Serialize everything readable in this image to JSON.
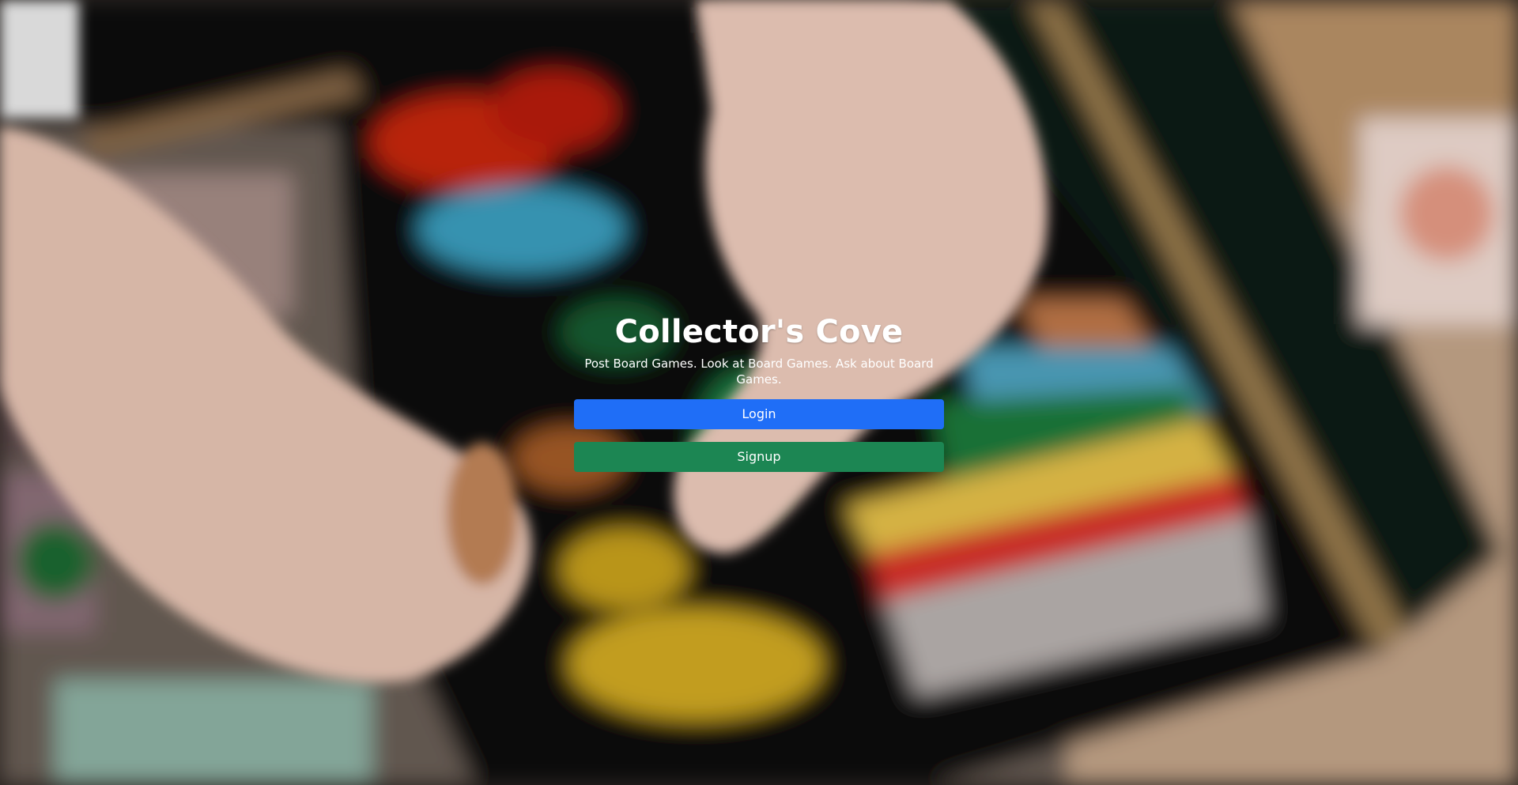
{
  "hero": {
    "title": "Collector's Cove",
    "tagline": "Post Board Games. Look at Board Games. Ask about Board Games."
  },
  "actions": {
    "login_label": "Login",
    "signup_label": "Signup"
  },
  "colors": {
    "login_button": "#1f6ef7",
    "signup_button": "#1c8653",
    "text": "#ffffff"
  },
  "background": {
    "icon": "blurred-board-game-photo"
  }
}
